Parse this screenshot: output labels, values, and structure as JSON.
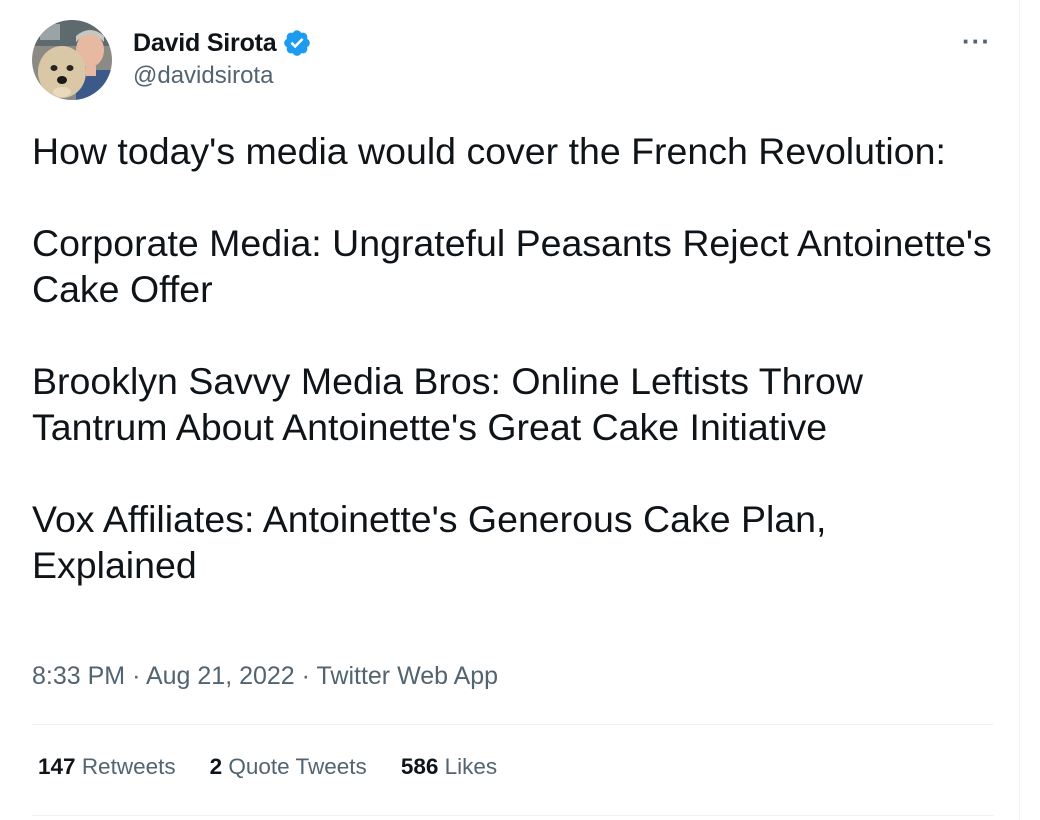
{
  "author": {
    "display_name": "David Sirota",
    "handle": "@davidsirota",
    "verified": true
  },
  "tweet": {
    "paragraphs": [
      "How today's media would cover the French Revolution:",
      "Corporate Media: Ungrateful Peasants Reject Antoinette's Cake Offer",
      "Brooklyn Savvy Media Bros: Online Leftists Throw Tantrum About Antoinette's Great Cake Initiative",
      "Vox Affiliates: Antoinette's Generous Cake Plan, Explained"
    ],
    "time": "8:33 PM",
    "date": "Aug 21, 2022",
    "separator": "·",
    "source": "Twitter Web App"
  },
  "stats": {
    "retweets": {
      "count": "147",
      "label": "Retweets"
    },
    "quote_tweets": {
      "count": "2",
      "label": "Quote Tweets"
    },
    "likes": {
      "count": "586",
      "label": "Likes"
    }
  },
  "icons": {
    "more": "more-options-icon",
    "verified": "verified-badge-icon"
  },
  "more_glyph": "···",
  "colors": {
    "text_primary": "#0f1419",
    "text_secondary": "#536471",
    "verified_blue": "#1d9bf0",
    "divider": "#eff3f4"
  }
}
